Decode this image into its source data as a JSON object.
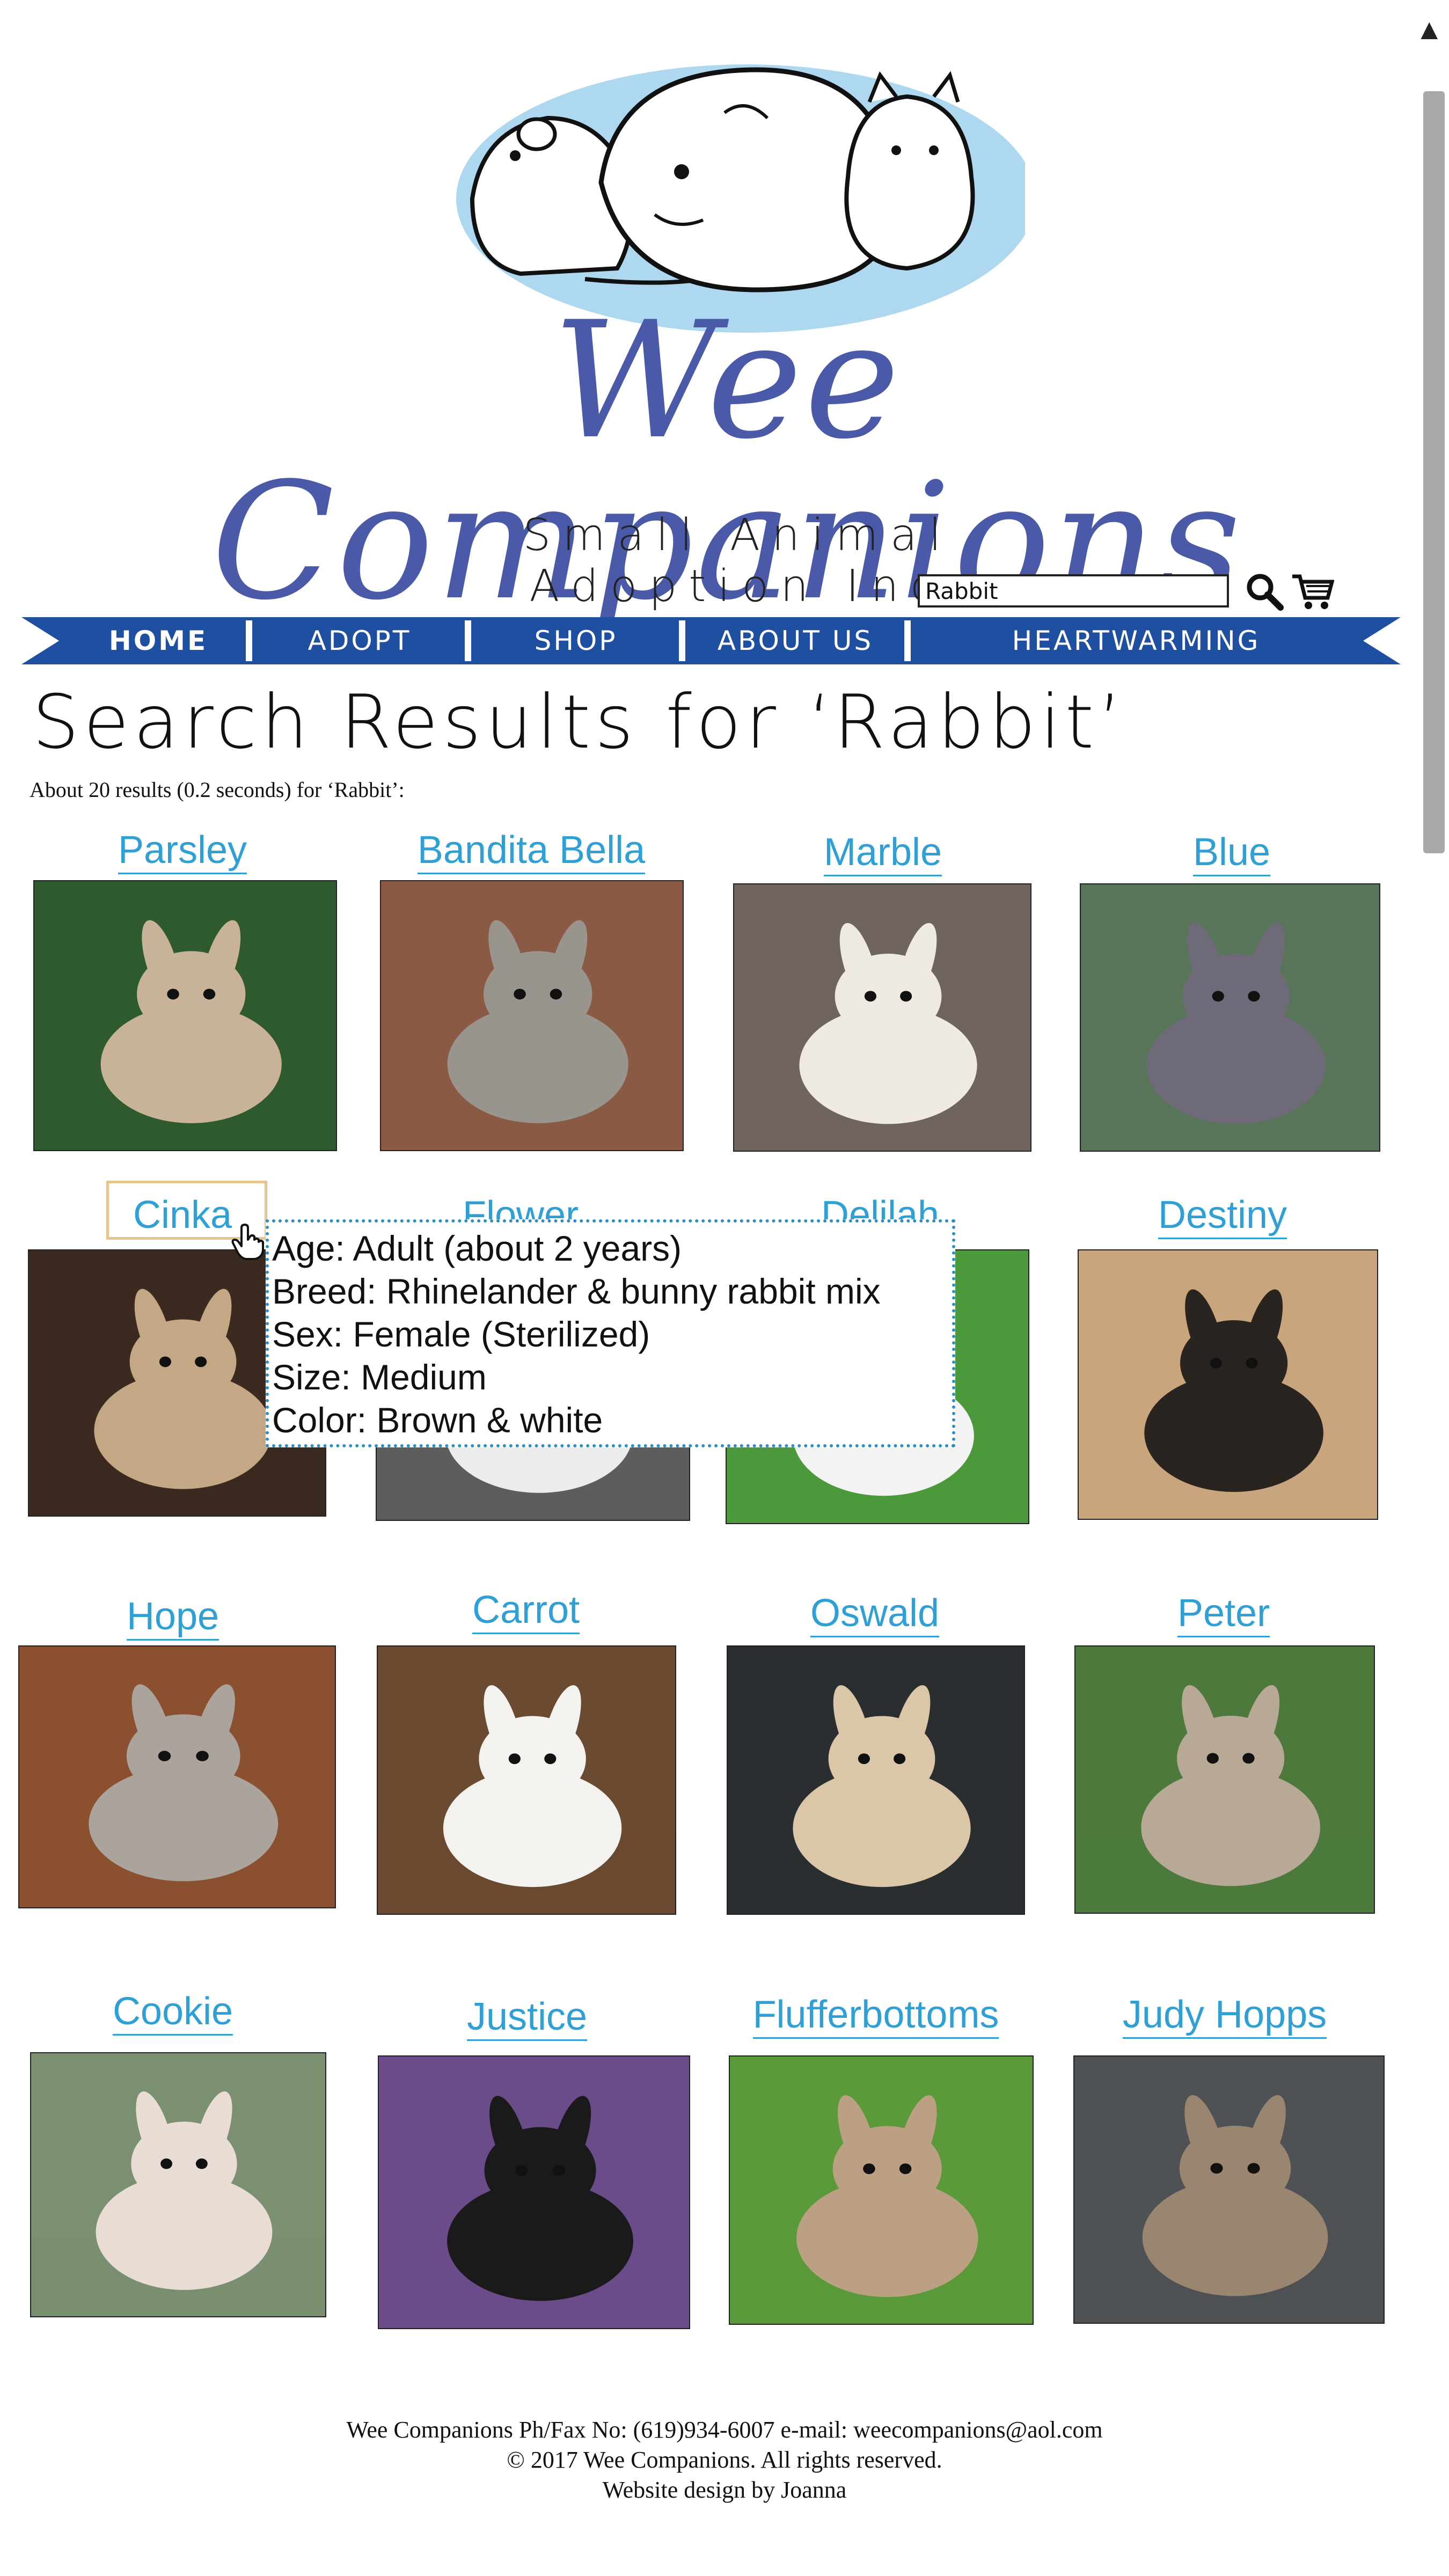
{
  "brand": {
    "name": "Wee Companions",
    "tagline": "Small Animal Adoption Inc"
  },
  "search": {
    "value": "Rabbit"
  },
  "nav": {
    "items": [
      "HOME",
      "ADOPT",
      "SHOP",
      "ABOUT US",
      "HEARTWARMING HAPPENINGS"
    ]
  },
  "results": {
    "title": "Search Results for ‘Rabbit’",
    "count": "About 20 results (0.2 seconds) for ‘Rabbit’:"
  },
  "pets": [
    {
      "name": "Parsley",
      "colors": [
        "#2e5a2e",
        "#c8b29a"
      ]
    },
    {
      "name": "Bandita Bella",
      "colors": [
        "#8a5a45",
        "#9a948e"
      ]
    },
    {
      "name": "Marble",
      "colors": [
        "#6f6460",
        "#efe9e4"
      ]
    },
    {
      "name": "Blue",
      "colors": [
        "#58755a",
        "#6e6a78"
      ]
    },
    {
      "name": "Cinka",
      "colors": [
        "#3a2a20",
        "#c4a886"
      ]
    },
    {
      "name": "Flower",
      "colors": [
        "#5e5e5e",
        "#ececec"
      ]
    },
    {
      "name": "Delilah",
      "colors": [
        "#4c9a3c",
        "#f3f3f3"
      ]
    },
    {
      "name": "Destiny",
      "colors": [
        "#c9a57e",
        "#2a2420"
      ]
    },
    {
      "name": "Hope",
      "colors": [
        "#8a5030",
        "#aaa49c"
      ]
    },
    {
      "name": "Carrot",
      "colors": [
        "#6a4a30",
        "#f4f2ee"
      ]
    },
    {
      "name": "Oswald",
      "colors": [
        "#2a2e30",
        "#dcc6a8"
      ]
    },
    {
      "name": "Peter",
      "colors": [
        "#4d7a3c",
        "#b8a896"
      ]
    },
    {
      "name": "Cookie",
      "colors": [
        "#7a9070",
        "#e8dcd4"
      ]
    },
    {
      "name": "Justice",
      "colors": [
        "#6a4c8a",
        "#1a1a1a"
      ]
    },
    {
      "name": "Flufferbottoms",
      "colors": [
        "#5a9a3a",
        "#bca084"
      ]
    },
    {
      "name": "Judy Hopps",
      "colors": [
        "#4e5254",
        "#9a8570"
      ]
    }
  ],
  "tooltip": {
    "age": "Age: Adult (about 2 years)",
    "breed": "Breed: Rhinelander & bunny rabbit mix",
    "sex": "Sex: Female (Sterilized)",
    "size": "Size: Medium",
    "color": "Color: Brown & white"
  },
  "footer": {
    "contact": "Wee Companions Ph/Fax No: (619)934-6007 e-mail: weecompanions@aol.com",
    "copyright": "© 2017 Wee Companions. All rights reserved.",
    "credit": "Website design by Joanna"
  },
  "theme": {
    "nav_blue": "#1f4fa0",
    "link_blue": "#2ea0d5",
    "brand_blue": "#4a5aa8",
    "tooltip_border": "#2a8fc4"
  }
}
